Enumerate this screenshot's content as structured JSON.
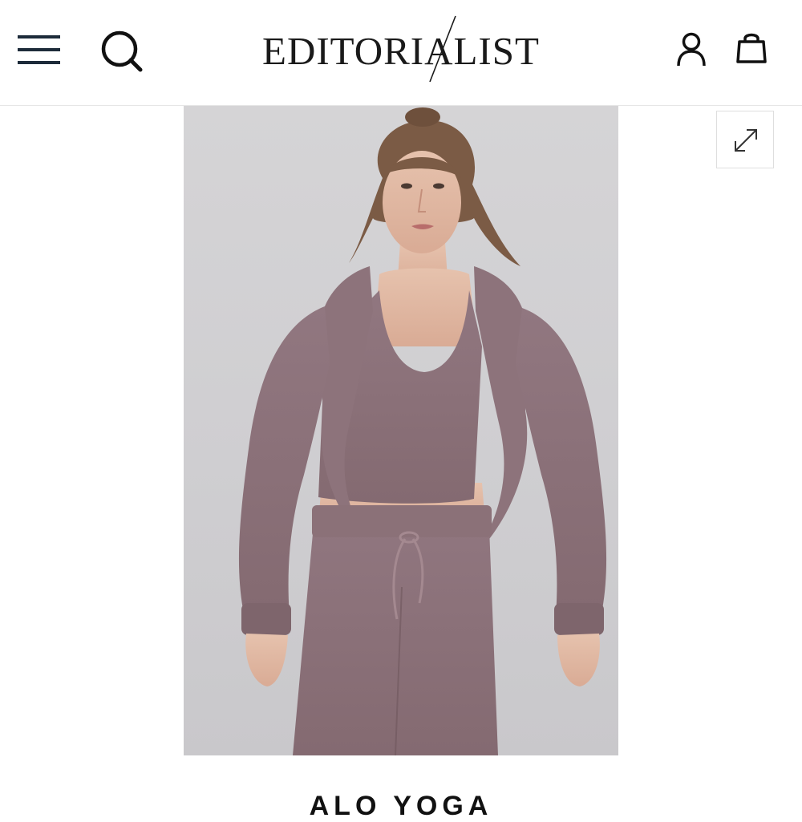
{
  "header": {
    "logo_text": "EDITORIALIST",
    "icons": {
      "menu": "hamburger-menu-icon",
      "search": "search-icon",
      "account": "user-icon",
      "bag": "shopping-bag-icon"
    }
  },
  "product": {
    "image_alt": "Model wearing mauve cozy knit cropped shrug, bra top and drawstring pants",
    "expand_icon": "expand-icon",
    "brand": "ALO YOGA"
  },
  "colors": {
    "text": "#1a1a1a",
    "knit_mauve": "#8a6f75",
    "image_bg": "#d3d2d5",
    "border": "#e6e6e6"
  }
}
